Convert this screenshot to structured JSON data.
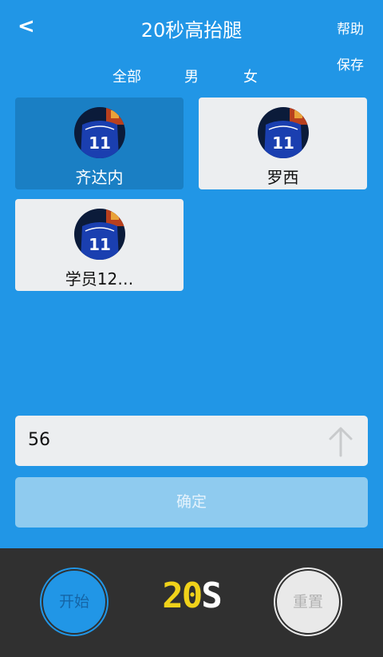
{
  "header": {
    "back_label": "<",
    "title": "20秒高抬腿",
    "help_label": "帮助",
    "save_label": "保存"
  },
  "filters": [
    "全部",
    "男",
    "女"
  ],
  "students": [
    {
      "name": "齐达内",
      "selected": true
    },
    {
      "name": "罗西",
      "selected": false
    },
    {
      "name": "学员12…",
      "selected": false
    }
  ],
  "input": {
    "value": "56",
    "icon": "arrow-up-icon"
  },
  "confirm_label": "确定",
  "controls": {
    "start_label": "开始",
    "reset_label": "重置",
    "timer_value": "20",
    "timer_unit": "S",
    "colors": {
      "timer_value": "#f0d21a",
      "accent": "#2196e6"
    }
  }
}
